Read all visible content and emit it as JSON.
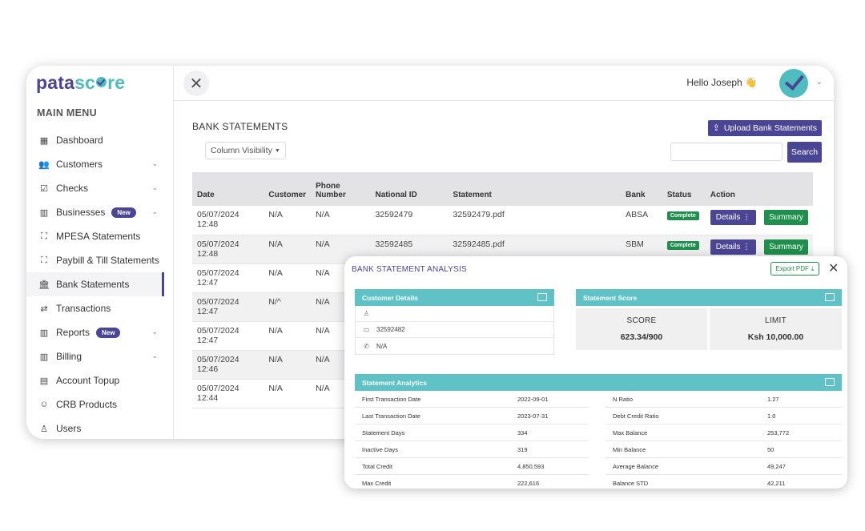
{
  "brand": {
    "part1": "pata",
    "part2": "sc",
    "part3": "re"
  },
  "sidebar": {
    "menu_title": "MAIN MENU",
    "items": [
      {
        "label": "Dashboard",
        "icon": "grid-icon",
        "chevron": false,
        "badge": ""
      },
      {
        "label": "Customers",
        "icon": "users-icon",
        "chevron": true,
        "badge": ""
      },
      {
        "label": "Checks",
        "icon": "checkbox-icon",
        "chevron": true,
        "badge": ""
      },
      {
        "label": "Businesses",
        "icon": "building-icon",
        "chevron": true,
        "badge": "New"
      },
      {
        "label": "MPESA Statements",
        "icon": "scan-icon",
        "chevron": false,
        "badge": ""
      },
      {
        "label": "Paybill & Till Statements",
        "icon": "scan-icon",
        "chevron": false,
        "badge": ""
      },
      {
        "label": "Bank Statements",
        "icon": "bank-icon",
        "chevron": false,
        "badge": "",
        "active": true
      },
      {
        "label": "Transactions",
        "icon": "transfer-icon",
        "chevron": false,
        "badge": ""
      },
      {
        "label": "Reports",
        "icon": "building-icon",
        "chevron": true,
        "badge": "New"
      },
      {
        "label": "Billing",
        "icon": "building-icon",
        "chevron": true,
        "badge": ""
      },
      {
        "label": "Account Topup",
        "icon": "card-icon",
        "chevron": false,
        "badge": ""
      },
      {
        "label": "CRB Products",
        "icon": "face-icon",
        "chevron": false,
        "badge": ""
      },
      {
        "label": "Users",
        "icon": "user-icon",
        "chevron": false,
        "badge": ""
      }
    ]
  },
  "header": {
    "greeting": "Hello Joseph 👋"
  },
  "page": {
    "title": "BANK STATEMENTS",
    "upload_label": "Upload Bank Statements",
    "column_visibility_label": "Column Visibility",
    "search_label": "Search"
  },
  "table": {
    "columns": [
      "Date",
      "Customer",
      "Phone Number",
      "National ID",
      "Statement",
      "Bank",
      "Status",
      "Action"
    ],
    "rows": [
      {
        "date": "05/07/2024 12:48",
        "customer": "N/A",
        "phone": "N/A",
        "national_id": "32592479",
        "statement": "32592479.pdf",
        "bank": "ABSA",
        "status": "Complete",
        "details": "Details ⋮",
        "summary": "Summary"
      },
      {
        "date": "05/07/2024 12:48",
        "customer": "N/A",
        "phone": "N/A",
        "national_id": "32592485",
        "statement": "32592485.pdf",
        "bank": "SBM",
        "status": "Complete",
        "details": "Details ⋮",
        "summary": "Summary"
      },
      {
        "date": "05/07/2024 12:47",
        "customer": "N/A",
        "phone": "N/A"
      },
      {
        "date": "05/07/2024 12:47",
        "customer": "N/^",
        "phone": "N/A"
      },
      {
        "date": "05/07/2024 12:47",
        "customer": "N/A",
        "phone": "N/A"
      },
      {
        "date": "05/07/2024 12:46",
        "customer": "N/A",
        "phone": "N/A"
      },
      {
        "date": "05/07/2024 12:44",
        "customer": "N/A",
        "phone": "N/A"
      }
    ]
  },
  "modal": {
    "title": "BANK STATEMENT ANALYSIS",
    "export_label": "Export PDF",
    "customer_details": {
      "heading": "Customer Details",
      "name": "",
      "id": "32592482",
      "phone": "N/A"
    },
    "statement_score": {
      "heading": "Statement Score",
      "score_label": "SCORE",
      "score_value": "623.34/900",
      "limit_label": "LIMIT",
      "limit_value": "Ksh 10,000.00"
    },
    "analytics": {
      "heading": "Statement Analytics",
      "left": [
        {
          "k": "First Transaction Date",
          "v": "2022-09-01"
        },
        {
          "k": "Last Transaction Date",
          "v": "2023-07-31"
        },
        {
          "k": "Statement Days",
          "v": "334"
        },
        {
          "k": "Inactive Days",
          "v": "319"
        },
        {
          "k": "Total Credit",
          "v": "4,850,593"
        },
        {
          "k": "Max Credit",
          "v": "222,616"
        }
      ],
      "right": [
        {
          "k": "N Ratio",
          "v": "1.27"
        },
        {
          "k": "Debt Credit Ratio",
          "v": "1.0"
        },
        {
          "k": "Max Balance",
          "v": "253,772"
        },
        {
          "k": "Min Balance",
          "v": "50"
        },
        {
          "k": "Average Balance",
          "v": "49,247"
        },
        {
          "k": "Balance STD",
          "v": "42,211"
        }
      ]
    }
  },
  "colors": {
    "brand_purple": "#4b4595",
    "brand_teal": "#4fbdc0",
    "success_green": "#1f8f4d",
    "panel_teal": "#5fc2c6"
  }
}
